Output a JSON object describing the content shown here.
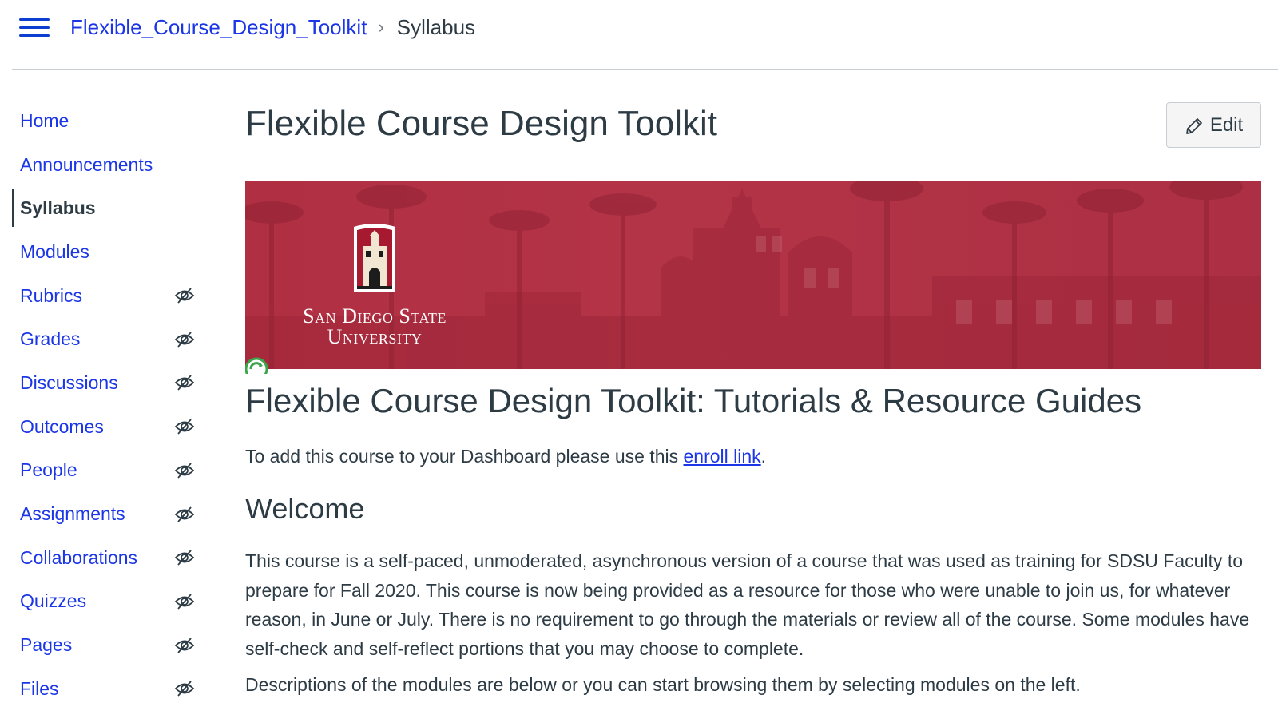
{
  "header": {
    "breadcrumb": {
      "course": "Flexible_Course_Design_Toolkit",
      "separator": "›",
      "current": "Syllabus"
    }
  },
  "sidebar": {
    "items": [
      {
        "label": "Home",
        "hidden": false,
        "active": false
      },
      {
        "label": "Announcements",
        "hidden": false,
        "active": false
      },
      {
        "label": "Syllabus",
        "hidden": false,
        "active": true
      },
      {
        "label": "Modules",
        "hidden": false,
        "active": false
      },
      {
        "label": "Rubrics",
        "hidden": true,
        "active": false
      },
      {
        "label": "Grades",
        "hidden": true,
        "active": false
      },
      {
        "label": "Discussions",
        "hidden": true,
        "active": false
      },
      {
        "label": "Outcomes",
        "hidden": true,
        "active": false
      },
      {
        "label": "People",
        "hidden": true,
        "active": false
      },
      {
        "label": "Assignments",
        "hidden": true,
        "active": false
      },
      {
        "label": "Collaborations",
        "hidden": true,
        "active": false
      },
      {
        "label": "Quizzes",
        "hidden": true,
        "active": false
      },
      {
        "label": "Pages",
        "hidden": true,
        "active": false
      },
      {
        "label": "Files",
        "hidden": true,
        "active": false
      }
    ]
  },
  "main": {
    "title": "Flexible Course Design Toolkit",
    "edit_label": "Edit",
    "banner": {
      "university_line1": "San Diego State",
      "university_line2": "University"
    },
    "heading": "Flexible Course Design Toolkit: Tutorials & Resource Guides",
    "enroll": {
      "before": "To add this course to your Dashboard please use this ",
      "link": "enroll link",
      "after": "."
    },
    "welcome_heading": "Welcome",
    "welcome_body": "This course is a self-paced, unmoderated, asynchronous version of a course that was used as training for SDSU Faculty to prepare for Fall 2020. This course is now being provided as a resource for those who were unable to join us, for whatever reason, in June or July. There is no requirement to go through the materials or review all of the course. Some modules have self-check and self-reflect portions that you may choose to complete.",
    "descriptions": "Descriptions of the modules are below or you can start browsing them by selecting modules on the left."
  },
  "colors": {
    "link": "#1a36e6",
    "text": "#2d3b45",
    "banner_red": "#b02f42",
    "divider": "#c7cdd1"
  },
  "icons": {
    "menu": "hamburger-icon",
    "edit": "pencil-icon",
    "hidden": "eye-slash-icon",
    "refresh": "refresh-icon"
  }
}
